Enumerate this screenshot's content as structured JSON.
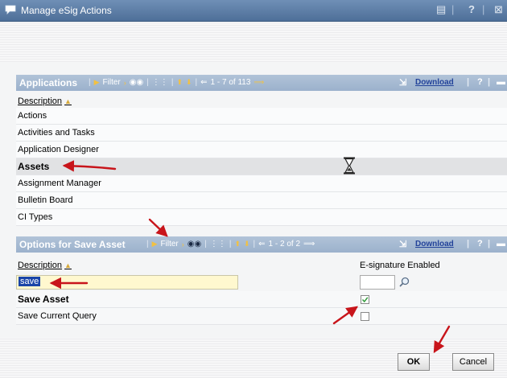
{
  "window": {
    "title": "Manage eSig Actions",
    "icon": "speech-bubble-icon"
  },
  "applications": {
    "title": "Applications",
    "filter_label": "Filter",
    "pagination": "1 - 7 of 113",
    "download_label": "Download",
    "help_label": "?",
    "column_header": "Description",
    "rows": [
      {
        "label": "Actions"
      },
      {
        "label": "Activities and Tasks"
      },
      {
        "label": "Application Designer"
      },
      {
        "label": "Assets"
      },
      {
        "label": "Assignment Manager"
      },
      {
        "label": "Bulletin Board"
      },
      {
        "label": "CI Types"
      }
    ],
    "selected_index": 3
  },
  "options": {
    "title": "Options for Save Asset",
    "filter_label": "Filter",
    "pagination": "1 - 2 of 2",
    "download_label": "Download",
    "help_label": "?",
    "column_description": "Description",
    "column_esig": "E-signature Enabled",
    "filter_value": "save",
    "rows": [
      {
        "label": "Save Asset",
        "esig_enabled": true
      },
      {
        "label": "Save Current Query",
        "esig_enabled": false
      }
    ]
  },
  "buttons": {
    "ok": "OK",
    "cancel": "Cancel"
  },
  "colors": {
    "title_bar": "#5b7ba6",
    "section_header": "#a8bcd3",
    "selection": "#1a45a8",
    "annotation_arrow": "#c8151b"
  }
}
